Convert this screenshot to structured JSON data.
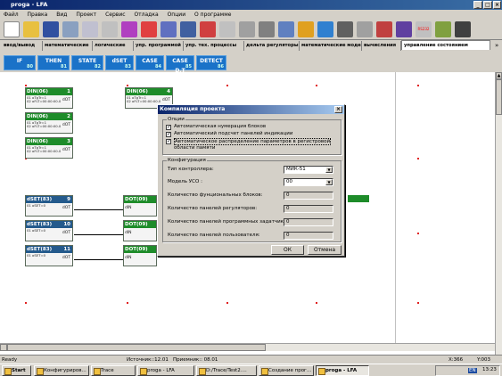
{
  "window": {
    "title": "proga - LFA"
  },
  "menu": [
    "Файл",
    "Правка",
    "Вид",
    "Проект",
    "Сервис",
    "Отладка",
    "Опции",
    "О программе"
  ],
  "tabs": [
    "ввод/вывод",
    "математические",
    "логические",
    "упр. программой",
    "упр. тех. процессы",
    "дельта регуляторы",
    "математические модели",
    "вычисления",
    "управление состоянием"
  ],
  "palette": [
    {
      "label": "IF",
      "num": "80"
    },
    {
      "label": "THEN",
      "num": "81"
    },
    {
      "label": "STATE",
      "num": "82"
    },
    {
      "label": "dSET",
      "num": "83"
    },
    {
      "label": "CASE",
      "num": "84"
    },
    {
      "label": "CASE D.T",
      "num": "85"
    },
    {
      "label": "DETECT",
      "num": "86"
    }
  ],
  "blocks": [
    {
      "title": "DIN(06)",
      "n": "1",
      "l1": "01 oTgTr=1",
      "l2": "02 oFLT=00:00:00.0",
      "out": "dOT"
    },
    {
      "title": "DIN(06)",
      "n": "2",
      "l1": "01 oTgTr=1",
      "l2": "02 oFLT=00:00:00.0",
      "out": "dOT"
    },
    {
      "title": "DIN(06)",
      "n": "3",
      "l1": "01 oTgTr=1",
      "l2": "02 oFLT=00:00:00.0",
      "out": "dOT"
    },
    {
      "title": "DIN(06)",
      "n": "4",
      "l1": "01 oTgTr=1",
      "l2": "02 oFLT=00:00:00.0",
      "out": "dOT"
    },
    {
      "title": "dSET(83)",
      "n": "9",
      "l1": "01 oSET=0",
      "out": "dOT"
    },
    {
      "title": "dSET(83)",
      "n": "10",
      "l1": "01 oSET=0",
      "out": "dOT"
    },
    {
      "title": "dSET(83)",
      "n": "11",
      "l1": "01 oSET=0",
      "out": "dOT"
    },
    {
      "title": "DOT(09)",
      "in": "dIN"
    },
    {
      "title": "DOT(09)",
      "in": "dIN"
    },
    {
      "title": "DOT(09)",
      "in": "dIN"
    }
  ],
  "dialog": {
    "title": "Компиляция проекта",
    "options_label": "Опции",
    "options": [
      "Автоматическая нумерация блоков",
      "Автоматический подсчет панелей индикации",
      "Автоматическое распределение параметров в регистровой",
      "области памяти"
    ],
    "config_label": "Конфигурация",
    "controller_label": "Тип контроллера:",
    "controller_value": "МИК-51",
    "uso_label": "Модель УСО :",
    "uso_value": "00",
    "func_blocks_label": "Количество фунциональных блоков:",
    "func_blocks_value": "0",
    "reg_panels_label": "Количество панелей регуляторов:",
    "reg_panels_value": "0",
    "prog_panels_label": "Количество панелей программных задатчиков:",
    "prog_panels_value": "0",
    "user_panels_label": "Количество панелей пользователя:",
    "user_panels_value": "0",
    "ok": "ОК",
    "cancel": "Отмена"
  },
  "status": {
    "ready": "Ready",
    "source": "Источник::12.01",
    "receiver": "Приемник:: 08.01",
    "x": "X:366",
    "y": "Y:003"
  },
  "taskbar": {
    "start": "Start",
    "tasks": [
      "Конфигуриров...",
      "Trace",
      "proga - LFA",
      "D:/Trace/Test2....",
      "Создание прог...",
      "proga - LFA"
    ],
    "lang": "EN",
    "time": "13:23"
  }
}
